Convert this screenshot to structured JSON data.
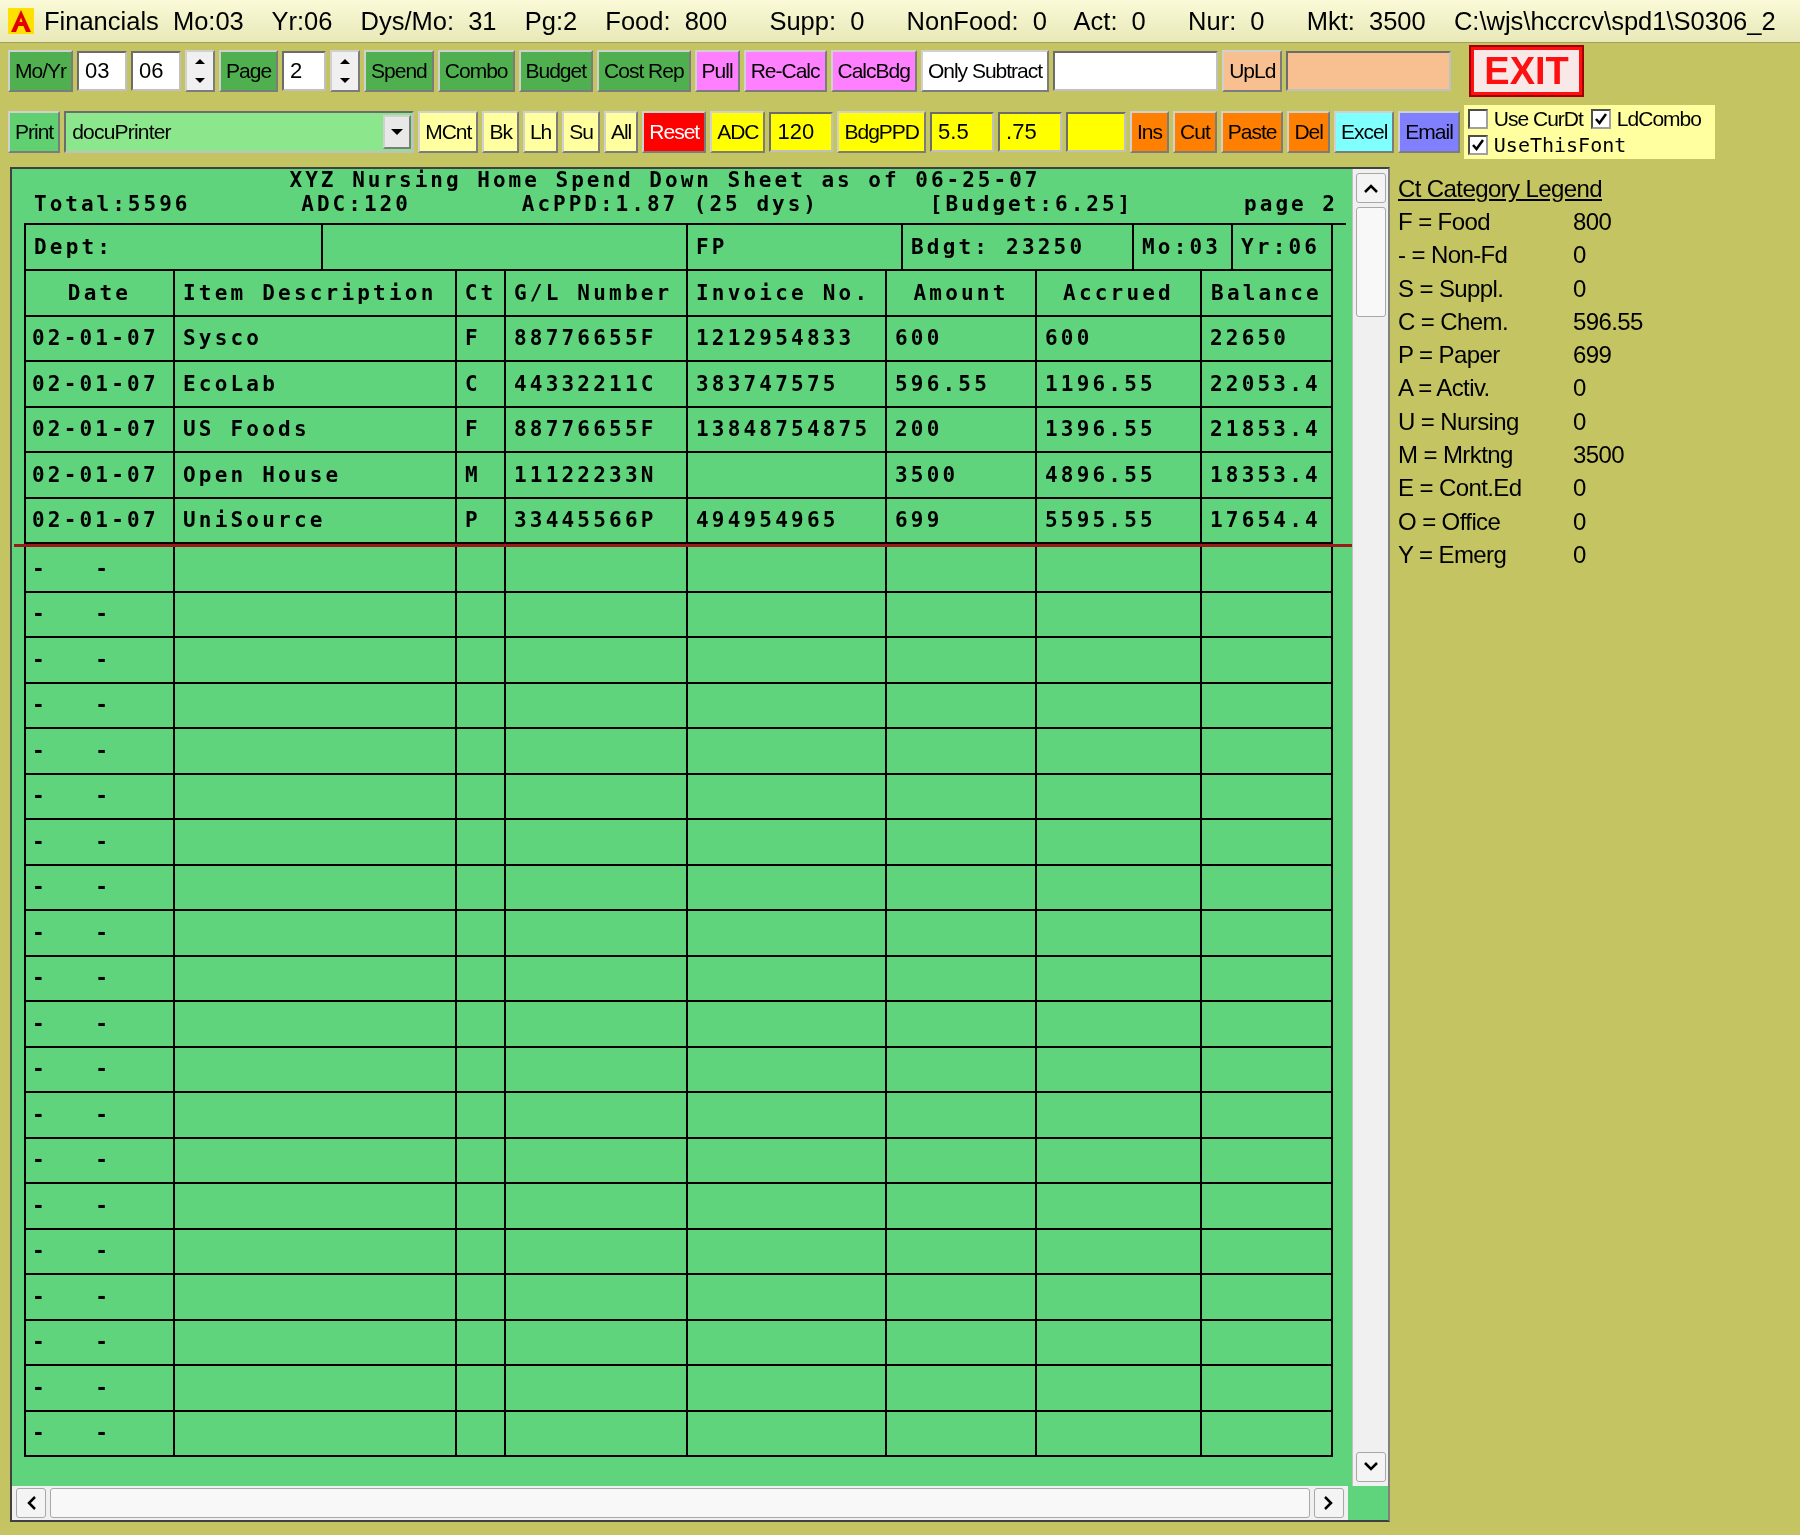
{
  "title_bar": {
    "text": "Financials Mo:03  Yr:06  Dys/Mo: 31  Pg:2  Food: 800   Supp: 0   NonFood: 0  Act: 0   Nur: 0   Mkt: 3500  C:\\wjs\\hccrcv\\spd1\\S0306_2"
  },
  "toolbar_rows": [
    [
      {
        "kind": "button",
        "label": "Mo/Yr",
        "color": "#50b050"
      },
      {
        "kind": "field",
        "value": "03",
        "color": "#ffffff"
      },
      {
        "kind": "field",
        "value": "06",
        "color": "#ffffff"
      },
      {
        "kind": "spinner"
      },
      {
        "kind": "button",
        "label": "Page",
        "color": "#50b050"
      },
      {
        "kind": "field",
        "value": "2",
        "color": "#ffffff"
      },
      {
        "kind": "spinner"
      },
      {
        "kind": "button",
        "label": "Spend",
        "color": "#50b050"
      },
      {
        "kind": "button",
        "label": "Combo",
        "color": "#50b050"
      },
      {
        "kind": "button",
        "label": "Budget",
        "color": "#50b050"
      },
      {
        "kind": "button",
        "label": "Cost Rep",
        "color": "#50b050"
      },
      {
        "kind": "button",
        "label": "Pull",
        "color": "#ff80ff"
      },
      {
        "kind": "button",
        "label": "Re-Calc",
        "color": "#ff80ff"
      },
      {
        "kind": "button",
        "label": "CalcBdg",
        "color": "#ff80ff"
      },
      {
        "kind": "button",
        "label": "Only Subtract",
        "color": "#ffffff"
      },
      {
        "kind": "field",
        "color": "#ffffff"
      },
      {
        "kind": "button",
        "label": "UpLd",
        "color": "#f8c090"
      },
      {
        "kind": "field",
        "color": "#f8c090"
      },
      {
        "kind": "exit",
        "label": "EXIT"
      }
    ],
    [
      {
        "kind": "button",
        "label": "Print",
        "color": "#60d070"
      },
      {
        "kind": "dropdown",
        "value": "docuPrinter"
      },
      {
        "kind": "button",
        "label": "MCnt",
        "color": "#ffffa0"
      },
      {
        "kind": "button",
        "label": "Bk",
        "color": "#ffffa0"
      },
      {
        "kind": "button",
        "label": "Lh",
        "color": "#ffffa0"
      },
      {
        "kind": "button",
        "label": "Su",
        "color": "#ffffa0"
      },
      {
        "kind": "button",
        "label": "All",
        "color": "#ffffa0"
      },
      {
        "kind": "button",
        "label": "Reset",
        "color": "#ff0000"
      },
      {
        "kind": "button",
        "label": "ADC",
        "color": "#ffff00"
      },
      {
        "kind": "field",
        "value": "120",
        "color": "#ffff00"
      },
      {
        "kind": "button",
        "label": "BdgPPD",
        "color": "#ffff00"
      },
      {
        "kind": "field",
        "value": "5.5",
        "color": "#ffff00"
      },
      {
        "kind": "field",
        "value": ".75",
        "color": "#ffff00"
      },
      {
        "kind": "field",
        "color": "#ffff00"
      },
      {
        "kind": "button",
        "label": "Ins",
        "color": "#ff8000"
      },
      {
        "kind": "button",
        "label": "Cut",
        "color": "#ff8000"
      },
      {
        "kind": "button",
        "label": "Paste",
        "color": "#ff8000"
      },
      {
        "kind": "button",
        "label": "Del",
        "color": "#ff8000"
      },
      {
        "kind": "button",
        "label": "Excel",
        "color": "#80ffff"
      },
      {
        "kind": "button",
        "label": "Email",
        "color": "#8080ff"
      },
      {
        "kind": "checkboxes",
        "items": [
          {
            "label": "Use CurDt",
            "checked": false
          },
          {
            "label": "LdCombo",
            "checked": true
          },
          {
            "label": "UseThisFont",
            "checked": true
          }
        ]
      }
    ]
  ],
  "sheet": {
    "title": "XYZ Nursing Home Spend Down Sheet as of 06-25-07",
    "summary": [
      "Total:5596",
      "ADC:120",
      "AcPPD:1.87 (25 dys)",
      "[Budget:6.25]",
      "page 2"
    ],
    "dept_row": [
      "Dept:",
      "FP",
      "Bdgt: 23250",
      "Mo:03",
      "Yr:06"
    ],
    "columns": [
      "Date",
      "Item Description",
      "Ct",
      "G/L Number",
      "Invoice No.",
      "Amount",
      "Accrued",
      "Balance"
    ],
    "rows": [
      {
        "cells": [
          "02-01-07",
          "Sysco",
          "F",
          "88776655F",
          "1212954833",
          "600",
          "600",
          "22650"
        ],
        "marked": false
      },
      {
        "cells": [
          "02-01-07",
          "EcoLab",
          "C",
          "44332211C",
          "383747575",
          "596.55",
          "1196.55",
          "22053.4"
        ],
        "marked": false
      },
      {
        "cells": [
          "02-01-07",
          "US Foods",
          "F",
          "88776655F",
          "13848754875",
          "200",
          "1396.55",
          "21853.4"
        ],
        "marked": false
      },
      {
        "cells": [
          "02-01-07",
          "Open House",
          "M",
          "11122233N",
          "",
          "3500",
          "4896.55",
          "18353.4"
        ],
        "marked": false
      },
      {
        "cells": [
          "02-01-07",
          "UniSource",
          "P",
          "33445566P",
          "494954965",
          "699",
          "5595.55",
          "17654.4"
        ],
        "marked": true
      },
      {
        "cells": [
          "-   -",
          "",
          "",
          "",
          "",
          "",
          "",
          ""
        ],
        "marked": false
      },
      {
        "cells": [
          "-   -",
          "",
          "",
          "",
          "",
          "",
          "",
          ""
        ],
        "marked": false
      },
      {
        "cells": [
          "-   -",
          "",
          "",
          "",
          "",
          "",
          "",
          ""
        ],
        "marked": false
      },
      {
        "cells": [
          "-   -",
          "",
          "",
          "",
          "",
          "",
          "",
          ""
        ],
        "marked": false
      },
      {
        "cells": [
          "-   -",
          "",
          "",
          "",
          "",
          "",
          "",
          ""
        ],
        "marked": false
      },
      {
        "cells": [
          "-   -",
          "",
          "",
          "",
          "",
          "",
          "",
          ""
        ],
        "marked": false
      },
      {
        "cells": [
          "-   -",
          "",
          "",
          "",
          "",
          "",
          "",
          ""
        ],
        "marked": false
      },
      {
        "cells": [
          "-   -",
          "",
          "",
          "",
          "",
          "",
          "",
          ""
        ],
        "marked": false
      },
      {
        "cells": [
          "-   -",
          "",
          "",
          "",
          "",
          "",
          "",
          ""
        ],
        "marked": false
      },
      {
        "cells": [
          "-   -",
          "",
          "",
          "",
          "",
          "",
          "",
          ""
        ],
        "marked": false
      },
      {
        "cells": [
          "-   -",
          "",
          "",
          "",
          "",
          "",
          "",
          ""
        ],
        "marked": false
      },
      {
        "cells": [
          "-   -",
          "",
          "",
          "",
          "",
          "",
          "",
          ""
        ],
        "marked": false
      },
      {
        "cells": [
          "-   -",
          "",
          "",
          "",
          "",
          "",
          "",
          ""
        ],
        "marked": false
      },
      {
        "cells": [
          "-   -",
          "",
          "",
          "",
          "",
          "",
          "",
          ""
        ],
        "marked": false
      },
      {
        "cells": [
          "-   -",
          "",
          "",
          "",
          "",
          "",
          "",
          ""
        ],
        "marked": false
      },
      {
        "cells": [
          "-   -",
          "",
          "",
          "",
          "",
          "",
          "",
          ""
        ],
        "marked": false
      },
      {
        "cells": [
          "-   -",
          "",
          "",
          "",
          "",
          "",
          "",
          ""
        ],
        "marked": false
      },
      {
        "cells": [
          "-   -",
          "",
          "",
          "",
          "",
          "",
          "",
          ""
        ],
        "marked": false
      },
      {
        "cells": [
          "-   -",
          "",
          "",
          "",
          "",
          "",
          "",
          ""
        ],
        "marked": false
      },
      {
        "cells": [
          "-   -",
          "",
          "",
          "",
          "",
          "",
          "",
          ""
        ],
        "marked": false
      }
    ]
  },
  "legend": {
    "title": "Ct Category Legend",
    "items": [
      {
        "label": "F = Food",
        "value": "800"
      },
      {
        "label": "- = Non-Fd",
        "value": "0"
      },
      {
        "label": "S = Suppl.",
        "value": "0"
      },
      {
        "label": "C = Chem.",
        "value": "596.55"
      },
      {
        "label": "P = Paper",
        "value": "699"
      },
      {
        "label": "A = Activ.",
        "value": "0"
      },
      {
        "label": "U = Nursing",
        "value": "0"
      },
      {
        "label": "M = Mrktng",
        "value": "3500"
      },
      {
        "label": "E = Cont.Ed",
        "value": "0"
      },
      {
        "label": "O = Office",
        "value": "0"
      },
      {
        "label": "Y = Emerg",
        "value": "0"
      }
    ]
  }
}
